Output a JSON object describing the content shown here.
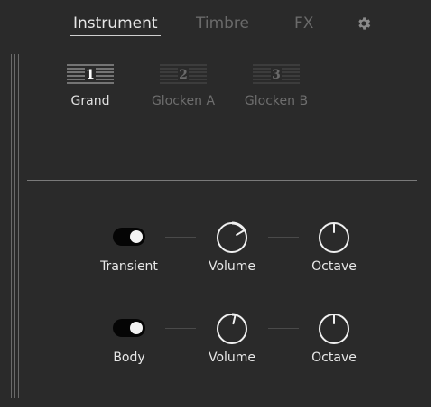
{
  "tabs": [
    {
      "label": "Instrument",
      "active": true
    },
    {
      "label": "Timbre",
      "active": false
    },
    {
      "label": "FX",
      "active": false
    }
  ],
  "settings_icon": "gear-icon",
  "presets": [
    {
      "number": "1",
      "label": "Grand",
      "active": true
    },
    {
      "number": "2",
      "label": "Glocken A",
      "active": false
    },
    {
      "number": "3",
      "label": "Glocken B",
      "active": false
    }
  ],
  "layers": [
    {
      "toggle_label": "Transient",
      "toggle_on": true,
      "volume_label": "Volume",
      "volume_level": 0.72,
      "octave_label": "Octave",
      "octave_level": 0.5
    },
    {
      "toggle_label": "Body",
      "toggle_on": true,
      "volume_label": "Volume",
      "volume_level": 0.55,
      "octave_label": "Octave",
      "octave_level": 0.5
    }
  ],
  "colors": {
    "panel": "#2a2a2a",
    "text_active": "#e6e6e6",
    "text_inactive": "#6a6a6a"
  }
}
